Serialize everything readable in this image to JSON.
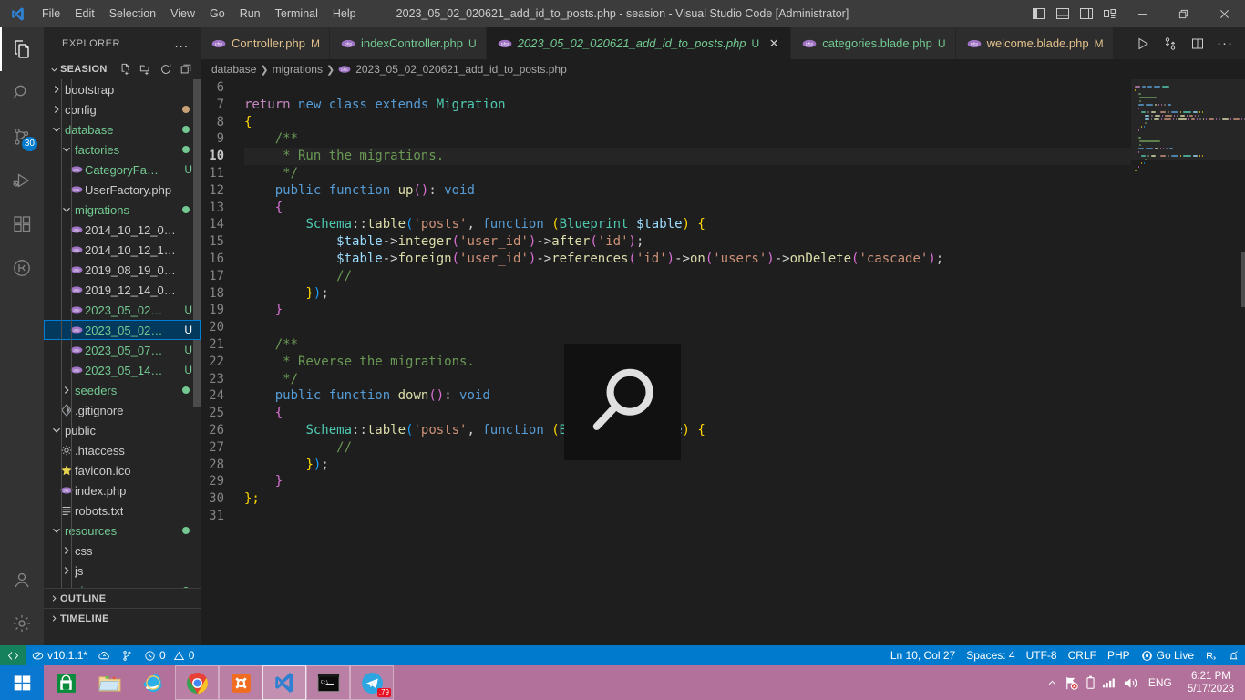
{
  "titlebar": {
    "title": "2023_05_02_020621_add_id_to_posts.php - seasion - Visual Studio Code [Administrator]",
    "menu": [
      "File",
      "Edit",
      "Selection",
      "View",
      "Go",
      "Run",
      "Terminal",
      "Help"
    ],
    "layout_buttons": [
      "toggle-primary-sidebar",
      "toggle-panel",
      "toggle-secondary-sidebar",
      "customize-layout"
    ],
    "window_buttons": [
      "minimize",
      "restore",
      "close"
    ]
  },
  "activitybar": {
    "items": [
      {
        "name": "explorer",
        "active": true
      },
      {
        "name": "search",
        "active": false
      },
      {
        "name": "source-control",
        "active": false,
        "badge": "30"
      },
      {
        "name": "run-and-debug",
        "active": false
      },
      {
        "name": "extensions",
        "active": false
      },
      {
        "name": "testing",
        "active": false
      }
    ],
    "bottom": [
      {
        "name": "accounts"
      },
      {
        "name": "manage-settings"
      }
    ]
  },
  "sidebar": {
    "header": "EXPLORER",
    "more_actions": "...",
    "project": "SEASION",
    "project_actions": [
      "new-file",
      "new-folder",
      "refresh-explorer",
      "collapse-folders"
    ],
    "tree": [
      {
        "label": "bootstrap",
        "type": "folder",
        "expanded": false,
        "depth": 1,
        "color": "default"
      },
      {
        "label": "config",
        "type": "folder",
        "expanded": false,
        "depth": 1,
        "color": "default",
        "dot": "#c8a177"
      },
      {
        "label": "database",
        "type": "folder",
        "expanded": true,
        "depth": 1,
        "color": "green",
        "dot": "#73c991"
      },
      {
        "label": "factories",
        "type": "folder",
        "expanded": true,
        "depth": 2,
        "color": "green",
        "dot": "#73c991"
      },
      {
        "label": "CategoryFact...",
        "type": "php",
        "depth": 3,
        "color": "green",
        "status": "U"
      },
      {
        "label": "UserFactory.php",
        "type": "php",
        "depth": 3,
        "color": "default"
      },
      {
        "label": "migrations",
        "type": "folder",
        "expanded": true,
        "depth": 2,
        "color": "green",
        "dot": "#73c991"
      },
      {
        "label": "2014_10_12_00000...",
        "type": "php",
        "depth": 3,
        "color": "default"
      },
      {
        "label": "2014_10_12_10000...",
        "type": "php",
        "depth": 3,
        "color": "default"
      },
      {
        "label": "2019_08_19_00000...",
        "type": "php",
        "depth": 3,
        "color": "default"
      },
      {
        "label": "2019_12_14_00000...",
        "type": "php",
        "depth": 3,
        "color": "default"
      },
      {
        "label": "2023_05_02_0...",
        "type": "php",
        "depth": 3,
        "color": "green",
        "status": "U"
      },
      {
        "label": "2023_05_02_0...",
        "type": "php",
        "depth": 3,
        "color": "green",
        "status": "U",
        "selected": true
      },
      {
        "label": "2023_05_07_1...",
        "type": "php",
        "depth": 3,
        "color": "green",
        "status": "U"
      },
      {
        "label": "2023_05_14_1...",
        "type": "php",
        "depth": 3,
        "color": "green",
        "status": "U"
      },
      {
        "label": "seeders",
        "type": "folder",
        "expanded": false,
        "depth": 2,
        "color": "green",
        "dot": "#73c991"
      },
      {
        "label": ".gitignore",
        "type": "git",
        "depth": 2,
        "color": "default"
      },
      {
        "label": "public",
        "type": "folder",
        "expanded": true,
        "depth": 1,
        "color": "default"
      },
      {
        "label": ".htaccess",
        "type": "config",
        "depth": 2,
        "color": "default"
      },
      {
        "label": "favicon.ico",
        "type": "image",
        "depth": 2,
        "color": "default"
      },
      {
        "label": "index.php",
        "type": "php",
        "depth": 2,
        "color": "default"
      },
      {
        "label": "robots.txt",
        "type": "text",
        "depth": 2,
        "color": "default"
      },
      {
        "label": "resources",
        "type": "folder",
        "expanded": true,
        "depth": 1,
        "color": "green",
        "dot": "#73c991"
      },
      {
        "label": "css",
        "type": "folder",
        "expanded": false,
        "depth": 2,
        "color": "default"
      },
      {
        "label": "js",
        "type": "folder",
        "expanded": false,
        "depth": 2,
        "color": "default"
      },
      {
        "label": "views",
        "type": "folder",
        "expanded": true,
        "depth": 2,
        "color": "green",
        "dot": "#73c991"
      }
    ],
    "panels": [
      {
        "label": "OUTLINE"
      },
      {
        "label": "TIMELINE"
      }
    ]
  },
  "editor": {
    "tabs": [
      {
        "label": "Controller.php",
        "badge": "M",
        "active": false,
        "color": "#e2c08d"
      },
      {
        "label": "indexController.php",
        "badge": "U",
        "active": false,
        "color": "#73c991"
      },
      {
        "label": "2023_05_02_020621_add_id_to_posts.php",
        "badge": "U",
        "active": true,
        "color": "#73c991",
        "closable": true
      },
      {
        "label": "categories.blade.php",
        "badge": "U",
        "active": false,
        "color": "#73c991"
      },
      {
        "label": "welcome.blade.php",
        "badge": "M",
        "active": false,
        "color": "#e2c08d"
      }
    ],
    "tab_actions": [
      "run-php-file",
      "split-git",
      "split-editor",
      "more-actions"
    ],
    "breadcrumbs": [
      "database",
      "migrations",
      "2023_05_02_020621_add_id_to_posts.php"
    ],
    "first_line_number": 6,
    "current_line": 10,
    "lines": [
      {
        "n": 6,
        "tokens": []
      },
      {
        "n": 7,
        "tokens": [
          {
            "t": "return ",
            "c": "t-kw2"
          },
          {
            "t": "new ",
            "c": "t-kw"
          },
          {
            "t": "class ",
            "c": "t-kw"
          },
          {
            "t": "extends ",
            "c": "t-kw"
          },
          {
            "t": "Migration",
            "c": "t-type"
          }
        ]
      },
      {
        "n": 8,
        "tokens": [
          {
            "t": "{",
            "c": "t-br1"
          }
        ]
      },
      {
        "n": 9,
        "tokens": [
          {
            "t": "    /**",
            "c": "t-com"
          }
        ]
      },
      {
        "n": 10,
        "tokens": [
          {
            "t": "     * Run the migrations.",
            "c": "t-com"
          }
        ]
      },
      {
        "n": 11,
        "tokens": [
          {
            "t": "     */",
            "c": "t-com"
          }
        ]
      },
      {
        "n": 12,
        "tokens": [
          {
            "t": "    ",
            "c": "t-op"
          },
          {
            "t": "public ",
            "c": "t-kw"
          },
          {
            "t": "function ",
            "c": "t-kw"
          },
          {
            "t": "up",
            "c": "t-fn"
          },
          {
            "t": "(",
            "c": "t-br2"
          },
          {
            "t": ")",
            "c": "t-br2"
          },
          {
            "t": ": ",
            "c": "t-punc"
          },
          {
            "t": "void",
            "c": "t-kw"
          }
        ]
      },
      {
        "n": 13,
        "tokens": [
          {
            "t": "    ",
            "c": "t-op"
          },
          {
            "t": "{",
            "c": "t-br2"
          }
        ]
      },
      {
        "n": 14,
        "tokens": [
          {
            "t": "        ",
            "c": "t-op"
          },
          {
            "t": "Schema",
            "c": "t-type"
          },
          {
            "t": "::",
            "c": "t-punc"
          },
          {
            "t": "table",
            "c": "t-fn"
          },
          {
            "t": "(",
            "c": "t-br3"
          },
          {
            "t": "'posts'",
            "c": "t-str"
          },
          {
            "t": ", ",
            "c": "t-punc"
          },
          {
            "t": "function ",
            "c": "t-kw"
          },
          {
            "t": "(",
            "c": "t-br1"
          },
          {
            "t": "Blueprint ",
            "c": "t-type"
          },
          {
            "t": "$table",
            "c": "t-var"
          },
          {
            "t": ")",
            "c": "t-br1"
          },
          {
            "t": " ",
            "c": "t-punc"
          },
          {
            "t": "{",
            "c": "t-br1"
          }
        ]
      },
      {
        "n": 15,
        "tokens": [
          {
            "t": "            ",
            "c": "t-op"
          },
          {
            "t": "$table",
            "c": "t-var"
          },
          {
            "t": "->",
            "c": "t-op"
          },
          {
            "t": "integer",
            "c": "t-fn"
          },
          {
            "t": "(",
            "c": "t-br2"
          },
          {
            "t": "'user_id'",
            "c": "t-str"
          },
          {
            "t": ")",
            "c": "t-br2"
          },
          {
            "t": "->",
            "c": "t-op"
          },
          {
            "t": "after",
            "c": "t-fn"
          },
          {
            "t": "(",
            "c": "t-br2"
          },
          {
            "t": "'id'",
            "c": "t-str"
          },
          {
            "t": ")",
            "c": "t-br2"
          },
          {
            "t": ";",
            "c": "t-punc"
          }
        ]
      },
      {
        "n": 16,
        "tokens": [
          {
            "t": "            ",
            "c": "t-op"
          },
          {
            "t": "$table",
            "c": "t-var"
          },
          {
            "t": "->",
            "c": "t-op"
          },
          {
            "t": "foreign",
            "c": "t-fn"
          },
          {
            "t": "(",
            "c": "t-br2"
          },
          {
            "t": "'user_id'",
            "c": "t-str"
          },
          {
            "t": ")",
            "c": "t-br2"
          },
          {
            "t": "->",
            "c": "t-op"
          },
          {
            "t": "references",
            "c": "t-fn"
          },
          {
            "t": "(",
            "c": "t-br2"
          },
          {
            "t": "'id'",
            "c": "t-str"
          },
          {
            "t": ")",
            "c": "t-br2"
          },
          {
            "t": "->",
            "c": "t-op"
          },
          {
            "t": "on",
            "c": "t-fn"
          },
          {
            "t": "(",
            "c": "t-br2"
          },
          {
            "t": "'users'",
            "c": "t-str"
          },
          {
            "t": ")",
            "c": "t-br2"
          },
          {
            "t": "->",
            "c": "t-op"
          },
          {
            "t": "onDelete",
            "c": "t-fn"
          },
          {
            "t": "(",
            "c": "t-br2"
          },
          {
            "t": "'cascade'",
            "c": "t-str"
          },
          {
            "t": ")",
            "c": "t-br2"
          },
          {
            "t": ";",
            "c": "t-punc"
          }
        ]
      },
      {
        "n": 17,
        "tokens": [
          {
            "t": "            //",
            "c": "t-com"
          }
        ]
      },
      {
        "n": 18,
        "tokens": [
          {
            "t": "        ",
            "c": "t-op"
          },
          {
            "t": "}",
            "c": "t-br1"
          },
          {
            "t": ")",
            "c": "t-br3"
          },
          {
            "t": ";",
            "c": "t-punc"
          }
        ]
      },
      {
        "n": 19,
        "tokens": [
          {
            "t": "    ",
            "c": "t-op"
          },
          {
            "t": "}",
            "c": "t-br2"
          }
        ]
      },
      {
        "n": 20,
        "tokens": []
      },
      {
        "n": 21,
        "tokens": [
          {
            "t": "    /**",
            "c": "t-com"
          }
        ]
      },
      {
        "n": 22,
        "tokens": [
          {
            "t": "     * Reverse the migrations.",
            "c": "t-com"
          }
        ]
      },
      {
        "n": 23,
        "tokens": [
          {
            "t": "     */",
            "c": "t-com"
          }
        ]
      },
      {
        "n": 24,
        "tokens": [
          {
            "t": "    ",
            "c": "t-op"
          },
          {
            "t": "public ",
            "c": "t-kw"
          },
          {
            "t": "function ",
            "c": "t-kw"
          },
          {
            "t": "down",
            "c": "t-fn"
          },
          {
            "t": "(",
            "c": "t-br2"
          },
          {
            "t": ")",
            "c": "t-br2"
          },
          {
            "t": ": ",
            "c": "t-punc"
          },
          {
            "t": "void",
            "c": "t-kw"
          }
        ]
      },
      {
        "n": 25,
        "tokens": [
          {
            "t": "    ",
            "c": "t-op"
          },
          {
            "t": "{",
            "c": "t-br2"
          }
        ]
      },
      {
        "n": 26,
        "tokens": [
          {
            "t": "        ",
            "c": "t-op"
          },
          {
            "t": "Schema",
            "c": "t-type"
          },
          {
            "t": "::",
            "c": "t-punc"
          },
          {
            "t": "table",
            "c": "t-fn"
          },
          {
            "t": "(",
            "c": "t-br3"
          },
          {
            "t": "'posts'",
            "c": "t-str"
          },
          {
            "t": ", ",
            "c": "t-punc"
          },
          {
            "t": "function ",
            "c": "t-kw"
          },
          {
            "t": "(",
            "c": "t-br1"
          },
          {
            "t": "Blueprint ",
            "c": "t-type"
          },
          {
            "t": "$table",
            "c": "t-var"
          },
          {
            "t": ")",
            "c": "t-br1"
          },
          {
            "t": " ",
            "c": "t-punc"
          },
          {
            "t": "{",
            "c": "t-br1"
          }
        ]
      },
      {
        "n": 27,
        "tokens": [
          {
            "t": "            //",
            "c": "t-com"
          }
        ]
      },
      {
        "n": 28,
        "tokens": [
          {
            "t": "        ",
            "c": "t-op"
          },
          {
            "t": "}",
            "c": "t-br1"
          },
          {
            "t": ")",
            "c": "t-br3"
          },
          {
            "t": ";",
            "c": "t-punc"
          }
        ]
      },
      {
        "n": 29,
        "tokens": [
          {
            "t": "    ",
            "c": "t-op"
          },
          {
            "t": "}",
            "c": "t-br2"
          }
        ]
      },
      {
        "n": 30,
        "tokens": [
          {
            "t": "};",
            "c": "t-br1"
          }
        ]
      },
      {
        "n": 31,
        "tokens": []
      }
    ],
    "overlay_icon": "search-magnifier-overlay"
  },
  "statusbar": {
    "remote_icon": "remote-window",
    "left": [
      {
        "name": "php-version",
        "label": "v10.1.1*",
        "icon": "php-icon"
      },
      {
        "name": "cloud-sync",
        "label": "",
        "icon": "cloud-icon"
      },
      {
        "name": "git-branch-icon",
        "label": "",
        "icon": "source-control-icon"
      },
      {
        "name": "problems",
        "label": "0 ⚠ 0",
        "icon": "error-icon"
      }
    ],
    "errors": "0",
    "warnings": "0",
    "right": [
      {
        "name": "cursor-position",
        "label": "Ln 10, Col 27"
      },
      {
        "name": "indentation",
        "label": "Spaces: 4"
      },
      {
        "name": "encoding",
        "label": "UTF-8"
      },
      {
        "name": "eol",
        "label": "CRLF"
      },
      {
        "name": "language-mode",
        "label": "PHP"
      },
      {
        "name": "go-live",
        "label": "Go Live"
      },
      {
        "name": "screencast-mode",
        "label": ""
      },
      {
        "name": "notifications",
        "label": ""
      }
    ]
  },
  "taskbar": {
    "start": "windows-start",
    "items": [
      {
        "name": "microsoft-store",
        "boxed": false
      },
      {
        "name": "file-explorer",
        "boxed": false
      },
      {
        "name": "internet-explorer",
        "boxed": false
      },
      {
        "name": "google-chrome",
        "boxed": true
      },
      {
        "name": "xampp",
        "boxed": true
      },
      {
        "name": "visual-studio-code",
        "boxed": true,
        "active": true
      },
      {
        "name": "command-prompt",
        "boxed": true
      },
      {
        "name": "telegram",
        "boxed": true,
        "badge": ".79"
      }
    ],
    "tray": {
      "show_hidden": "show-hidden-icons",
      "network": "network-disconnected",
      "battery": "battery-icon",
      "signal": "signal-icon",
      "volume": "volume-icon",
      "language": "ENG",
      "time": "6:21 PM",
      "date": "5/17/2023"
    }
  }
}
